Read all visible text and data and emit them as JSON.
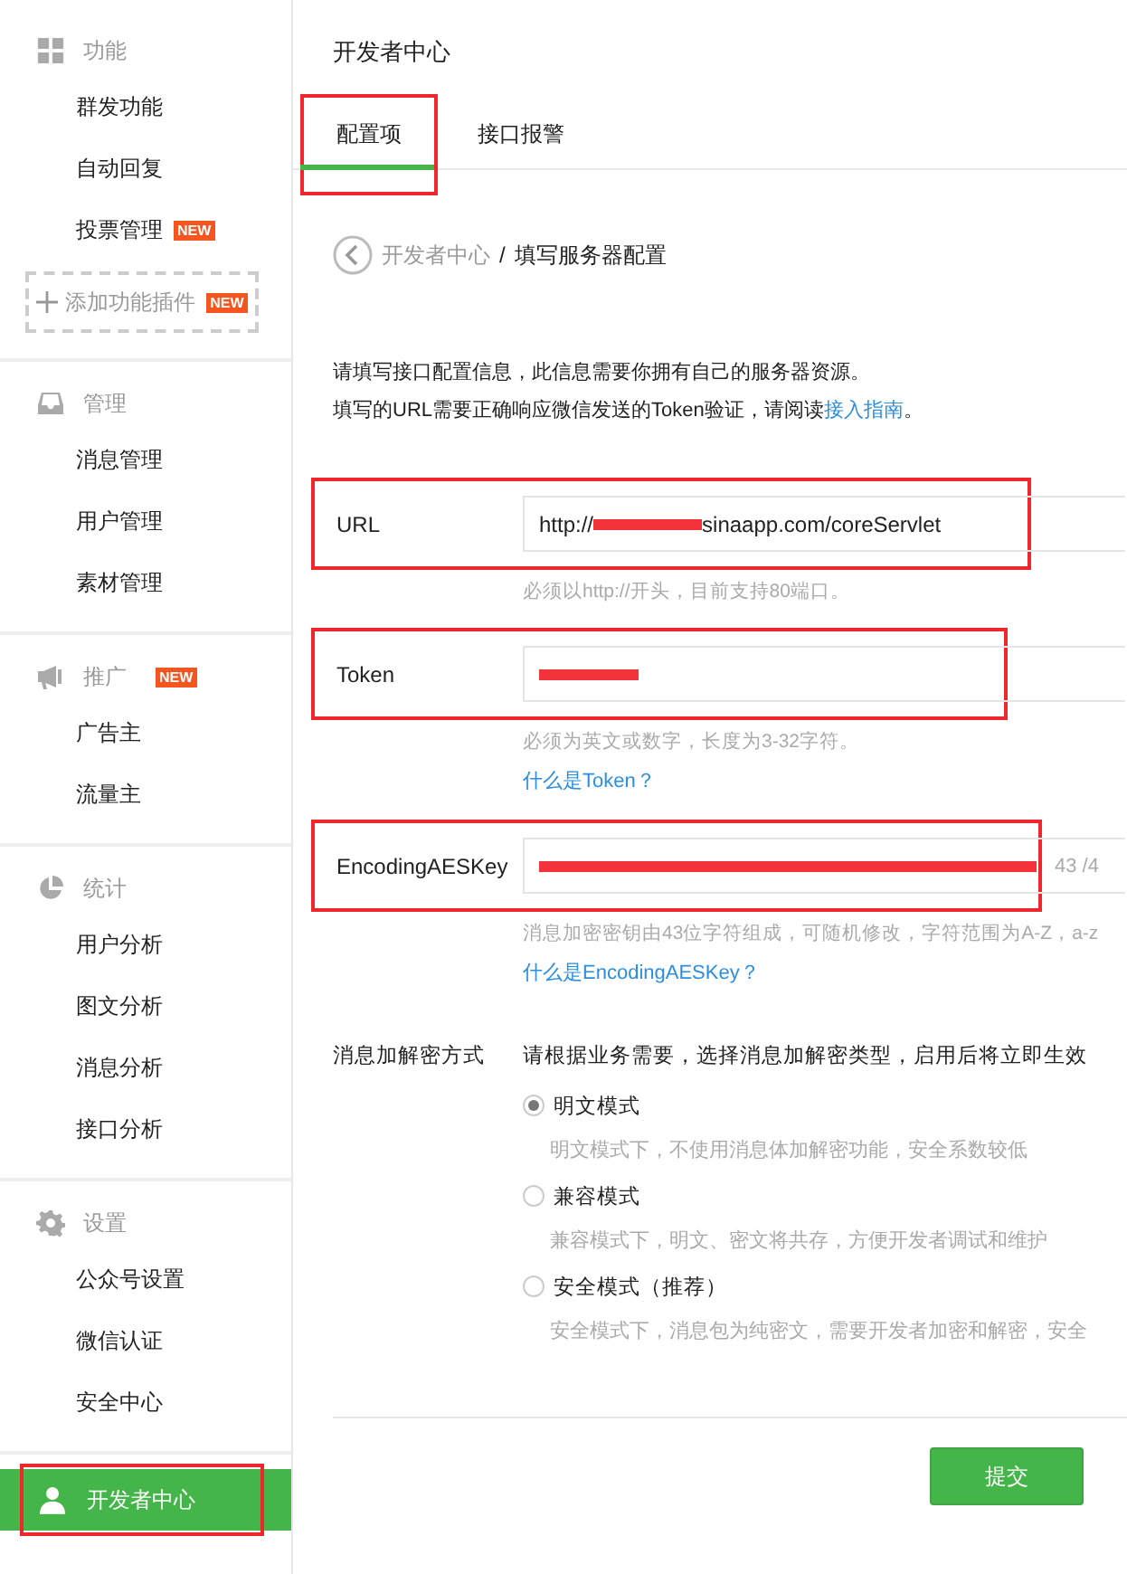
{
  "sidebar": {
    "sections": [
      {
        "kind": "group",
        "title": "功能",
        "items": [
          {
            "label": "群发功能",
            "selected": false
          },
          {
            "label": "自动回复",
            "selected": false
          },
          {
            "label": "投票管理",
            "badge": "NEW",
            "selected": false
          }
        ],
        "add_button": {
          "label": "添加功能插件",
          "badge": "NEW"
        }
      },
      {
        "kind": "group",
        "title": "管理",
        "items": [
          {
            "label": "消息管理",
            "selected": false
          },
          {
            "label": "用户管理",
            "selected": false
          },
          {
            "label": "素材管理",
            "selected": false
          }
        ]
      },
      {
        "kind": "group",
        "title": "推广",
        "badge": "NEW",
        "items": [
          {
            "label": "广告主",
            "selected": false
          },
          {
            "label": "流量主",
            "selected": false
          }
        ]
      },
      {
        "kind": "group",
        "title": "统计",
        "items": [
          {
            "label": "用户分析",
            "selected": false
          },
          {
            "label": "图文分析",
            "selected": false
          },
          {
            "label": "消息分析",
            "selected": false
          },
          {
            "label": "接口分析",
            "selected": false
          }
        ]
      },
      {
        "kind": "group",
        "title": "设置",
        "items": [
          {
            "label": "公众号设置",
            "selected": false
          },
          {
            "label": "微信认证",
            "selected": false
          },
          {
            "label": "安全中心",
            "selected": false
          }
        ]
      },
      {
        "kind": "link",
        "title": "开发者中心",
        "selected": true,
        "highlighted": true
      }
    ]
  },
  "page": {
    "title": "开发者中心",
    "tabs": [
      {
        "label": "配置项",
        "selected": true,
        "highlighted": true
      },
      {
        "label": "接口报警",
        "selected": false,
        "highlighted": false
      }
    ],
    "breadcrumb": {
      "parent": "开发者中心",
      "separator": "/",
      "current": "填写服务器配置"
    },
    "intro": [
      {
        "text": "请填写接口配置信息，此信息需要你拥有自己的服务器资源。"
      },
      {
        "text": "填写的URL需要正确响应微信发送的Token验证，请阅读",
        "link": "接入指南",
        "tail": "。"
      }
    ],
    "fields": [
      {
        "label": "URL",
        "value_start": "http://",
        "redacted": true,
        "value_end": "sinaapp.com/coreServlet",
        "hint": "必须以http://开头，目前支持80端口。",
        "highlighted": true
      },
      {
        "label": "Token",
        "redacted": true,
        "hint": "必须为英文或数字，长度为3-32字符。",
        "link": "什么是Token？",
        "highlighted": true
      },
      {
        "label": "EncodingAESKey",
        "redacted": true,
        "counter": "43 /4",
        "hint": "消息加密密钥由43位字符组成，可随机修改，字符范围为A-Z，a-z",
        "link": "什么是EncodingAESKey？",
        "highlighted": true
      }
    ],
    "encryption": {
      "label": "消息加解密方式",
      "description": "请根据业务需要，选择消息加解密类型，启用后将立即生效",
      "options": [
        {
          "label": "明文模式",
          "description": "明文模式下，不使用消息体加解密功能，安全系数较低",
          "selected": true
        },
        {
          "label": "兼容模式",
          "description": "兼容模式下，明文、密文将共存，方便开发者调试和维护",
          "selected": false
        },
        {
          "label": "安全模式（推荐）",
          "description": "安全模式下，消息包为纯密文，需要开发者加密和解密，安全",
          "selected": false
        }
      ]
    },
    "submit": "提交"
  }
}
